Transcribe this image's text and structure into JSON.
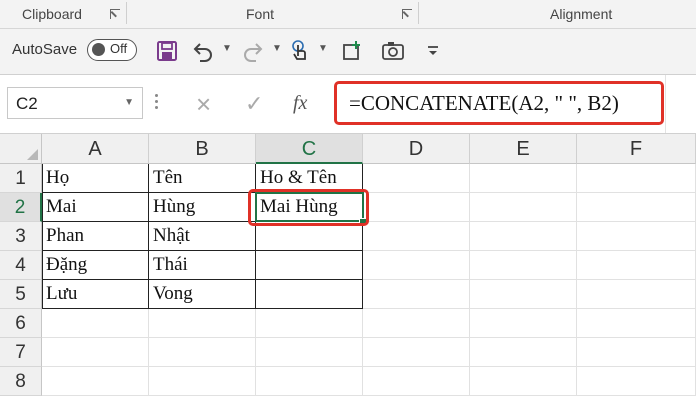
{
  "ribbon": {
    "groups": [
      "Clipboard",
      "Font",
      "Alignment"
    ]
  },
  "qat": {
    "autosave_label": "AutoSave",
    "autosave_state": "Off",
    "icons": [
      "save-icon",
      "undo-icon",
      "redo-icon",
      "touch-mode-icon",
      "add-icon",
      "camera-icon",
      "customize-icon"
    ]
  },
  "formula_bar": {
    "name_box": "C2",
    "formula": "=CONCATENATE(A2, \" \", B2)",
    "cancel_icon": "×",
    "enter_icon": "✓",
    "fx_label": "fx"
  },
  "grid": {
    "columns": [
      "A",
      "B",
      "C",
      "D",
      "E",
      "F"
    ],
    "rows": [
      "1",
      "2",
      "3",
      "4",
      "5",
      "6",
      "7",
      "8"
    ],
    "cells": [
      [
        "Họ",
        "Tên",
        "Ho & Tên"
      ],
      [
        "Mai",
        "Hùng",
        "Mai Hùng"
      ],
      [
        "Phan",
        "Nhật",
        ""
      ],
      [
        "Đặng",
        "Thái",
        ""
      ],
      [
        "Lưu",
        "Vong",
        ""
      ]
    ],
    "active_cell": "C2"
  },
  "colors": {
    "excel_green": "#217346",
    "highlight_red": "#e03127"
  }
}
